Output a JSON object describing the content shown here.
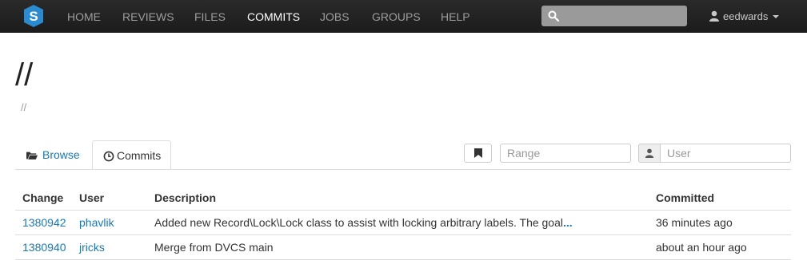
{
  "navbar": {
    "logo_letter": "S",
    "items": [
      {
        "label": "HOME",
        "active": false
      },
      {
        "label": "REVIEWS",
        "active": false
      },
      {
        "label": "FILES",
        "active": false
      },
      {
        "label": "COMMITS",
        "active": true
      },
      {
        "label": "JOBS",
        "active": false
      },
      {
        "label": "GROUPS",
        "active": false
      },
      {
        "label": "HELP",
        "active": false
      }
    ],
    "search_value": "",
    "username": "eedwards"
  },
  "page": {
    "title": "//",
    "subtitle": "//"
  },
  "tabs": [
    {
      "label": "Browse",
      "icon": "folder-open-icon",
      "active": false
    },
    {
      "label": "Commits",
      "icon": "clock-icon",
      "active": true
    }
  ],
  "filters": {
    "range_placeholder": "Range",
    "user_placeholder": "User"
  },
  "table": {
    "headers": [
      "Change",
      "User",
      "Description",
      "Committed"
    ],
    "rows": [
      {
        "change": "1380942",
        "user": "phavlik",
        "description": "Added new Record\\Lock\\Lock class to assist with locking arbitrary labels. The goal",
        "more": "...",
        "committed": "36 minutes ago"
      },
      {
        "change": "1380940",
        "user": "jricks",
        "description": "Merge from DVCS main",
        "more": "",
        "committed": "about an hour ago"
      }
    ]
  },
  "colors": {
    "navbar_bg": "#222222",
    "link": "#1a78b8",
    "logo": "#2a8bd0"
  }
}
